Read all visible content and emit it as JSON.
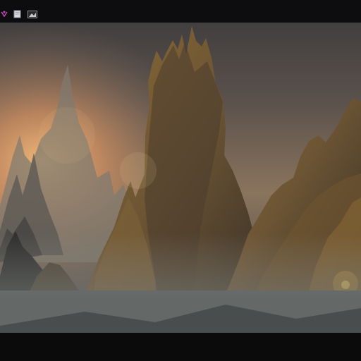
{
  "toolbar": {
    "icons": [
      "app-icon",
      "document-icon",
      "image-icon"
    ],
    "accent": "#b23ca8"
  },
  "viewer": {
    "palette": {
      "sky_top": "#4a4543",
      "glow": "#e0a86a",
      "rock": "#6b5330",
      "rock_dark": "#2a241d",
      "mist": "#7f807d",
      "water": "#2e3336"
    }
  },
  "status": {
    "left_text": "",
    "right_text": ""
  }
}
